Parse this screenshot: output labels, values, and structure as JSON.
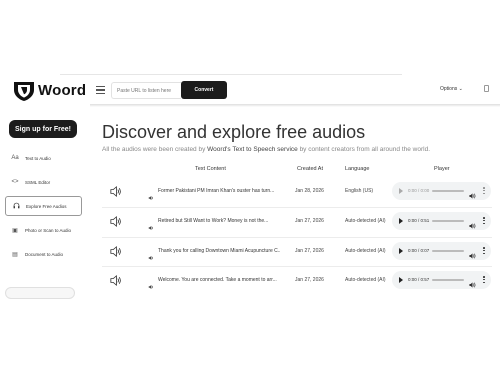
{
  "header": {
    "brand": "Woord",
    "url_placeholder": "Paste URL to listen here",
    "convert_label": "Convert",
    "options_label": "Options ⌄"
  },
  "sidebar": {
    "signup_label": "Sign up for Free!",
    "items": [
      {
        "label": "Text to Audio",
        "icon": "text-size-icon",
        "glyph": "Aa"
      },
      {
        "label": "SSML Editor",
        "icon": "code-icon",
        "glyph": "<>"
      },
      {
        "label": "Explore Free Audios",
        "icon": "headphones-icon",
        "glyph": "🎧"
      },
      {
        "label": "Photo or Scan to Audio",
        "icon": "image-icon",
        "glyph": "▣"
      },
      {
        "label": "Document to Audio",
        "icon": "document-icon",
        "glyph": "▤"
      }
    ]
  },
  "main": {
    "title": "Discover and explore free audios",
    "subtitle_prefix": "All the audios were been created by ",
    "subtitle_link": "Woord's Text to Speech service",
    "subtitle_suffix": " by content creators from all around the world.",
    "columns": [
      "Text Content",
      "Created At",
      "Language",
      "Player"
    ],
    "rows": [
      {
        "text": "Former Pakistani PM Imran Khan's ouster has turn...",
        "date": "Jan 28, 2026",
        "language": "English (US)",
        "time": "0:00 / 0:00",
        "disabled": true
      },
      {
        "text": "Retired but Still Want to Work? Money is not the...",
        "date": "Jan 27, 2026",
        "language": "Auto-detected (AI)",
        "time": "0:00 / 0:51",
        "disabled": false
      },
      {
        "text": "Thank you for calling Downtown Miami Acupuncture C...",
        "date": "Jan 27, 2026",
        "language": "Auto-detected (AI)",
        "time": "0:00 / 0:07",
        "disabled": false
      },
      {
        "text": "Welcome. You are connected. Take a moment to arr...",
        "date": "Jan 27, 2026",
        "language": "Auto-detected (AI)",
        "time": "0:00 / 0:57",
        "disabled": false
      }
    ]
  }
}
